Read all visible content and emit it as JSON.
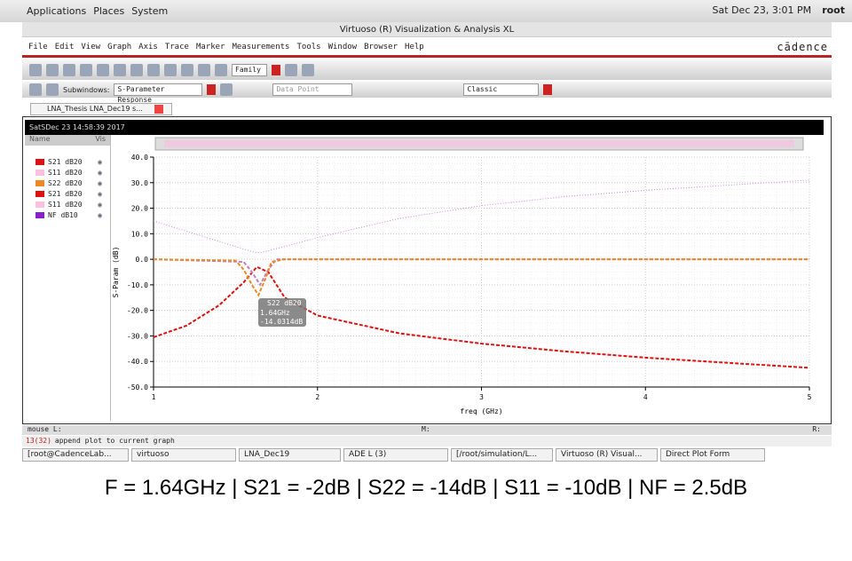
{
  "panel": {
    "apps": "Applications",
    "places": "Places",
    "system": "System",
    "datetime": "Sat Dec 23,  3:01 PM",
    "user": "root"
  },
  "window": {
    "title": "Virtuoso (R) Visualization & Analysis XL",
    "brand": "cādence"
  },
  "menu": [
    "File",
    "Edit",
    "View",
    "Graph",
    "Axis",
    "Trace",
    "Marker",
    "Measurements",
    "Tools",
    "Window",
    "Browser",
    "Help"
  ],
  "toolbar": {
    "family": "Family",
    "subwindows_label": "Subwindows:",
    "subwindow_value": "S-Parameter Response",
    "marker_type": "Data Point",
    "style": "Classic"
  },
  "tab": {
    "label": "LNA_Thesis LNA_Dec19 s..."
  },
  "plot_header": "SatSDec 23 14:58:39 2017",
  "legend": {
    "name_header": "Name",
    "vis_header": "Vis",
    "items": [
      {
        "label": "S21 dB20",
        "color": "#dd1111"
      },
      {
        "label": "S11 dB20",
        "color": "#ffc0e0"
      },
      {
        "label": "S22 dB20",
        "color": "#ee8822"
      },
      {
        "label": "S21 dB20",
        "color": "#dd1111"
      },
      {
        "label": "S11 dB20",
        "color": "#ffc0e0"
      },
      {
        "label": "NF dB10",
        "color": "#8a1ec8"
      }
    ]
  },
  "marker": {
    "trace": "S22 dB20",
    "x": "1.64GHz",
    "y": "-14.0314dB"
  },
  "chart_data": {
    "type": "line",
    "xlabel": "freq (GHz)",
    "ylabel": "S-Param (dB)",
    "xlim": [
      1,
      5
    ],
    "ylim": [
      -50,
      40
    ],
    "xticks": [
      "1",
      "2",
      "3",
      "4",
      "5"
    ],
    "yticks": [
      "40.0",
      "30.0",
      "20.0",
      "10.0",
      "0.0",
      "-10.0",
      "-20.0",
      "-30.0",
      "-40.0",
      "-50.0"
    ],
    "grid": true,
    "series": [
      {
        "name": "NF dB10",
        "color": "#cc88dd",
        "dash": "1,2",
        "points": [
          [
            1,
            15
          ],
          [
            1.2,
            11
          ],
          [
            1.4,
            7
          ],
          [
            1.6,
            3
          ],
          [
            1.65,
            2.5
          ],
          [
            1.8,
            5
          ],
          [
            2,
            8.5
          ],
          [
            2.5,
            16
          ],
          [
            3,
            21
          ],
          [
            3.5,
            24.5
          ],
          [
            4,
            27
          ],
          [
            4.5,
            29
          ],
          [
            5,
            31
          ]
        ]
      },
      {
        "name": "S21 dB20",
        "color": "#dd1111",
        "dash": "4,2",
        "points": [
          [
            1,
            -30.5
          ],
          [
            1.2,
            -26
          ],
          [
            1.4,
            -18
          ],
          [
            1.55,
            -9
          ],
          [
            1.63,
            -3
          ],
          [
            1.7,
            -5
          ],
          [
            1.8,
            -15
          ],
          [
            2,
            -22
          ],
          [
            2.5,
            -29
          ],
          [
            3,
            -33
          ],
          [
            3.5,
            -36
          ],
          [
            4,
            -38.5
          ],
          [
            4.5,
            -40.5
          ],
          [
            5,
            -42.5
          ]
        ]
      },
      {
        "name": "S11 dB20",
        "color": "#c080c0",
        "dash": "4,2",
        "points": [
          [
            1,
            0
          ],
          [
            1.55,
            -1
          ],
          [
            1.6,
            -5
          ],
          [
            1.65,
            -10
          ],
          [
            1.7,
            -4
          ],
          [
            1.75,
            0
          ],
          [
            5,
            0
          ]
        ]
      },
      {
        "name": "S22 dB20",
        "color": "#ee8822",
        "dash": "4,2",
        "points": [
          [
            1,
            0
          ],
          [
            1.5,
            -0.5
          ],
          [
            1.55,
            -4
          ],
          [
            1.6,
            -10
          ],
          [
            1.64,
            -14
          ],
          [
            1.68,
            -8
          ],
          [
            1.72,
            -1
          ],
          [
            1.8,
            0
          ],
          [
            5,
            0
          ]
        ]
      }
    ]
  },
  "status": {
    "mouse": "mouse L:",
    "middle": "M:",
    "right": "R:"
  },
  "command": {
    "prompt": "13(32)",
    "text": "append plot to current graph"
  },
  "taskbar": [
    "[root@CadenceLab...",
    "virtuoso",
    "LNA_Dec19",
    "ADE L (3)",
    "[/root/simulation/L...",
    "Virtuoso (R) Visual...",
    "Direct Plot Form"
  ],
  "caption": "F = 1.64GHz | S21 = -2dB | S22 = -14dB | S11 = -10dB | NF = 2.5dB"
}
